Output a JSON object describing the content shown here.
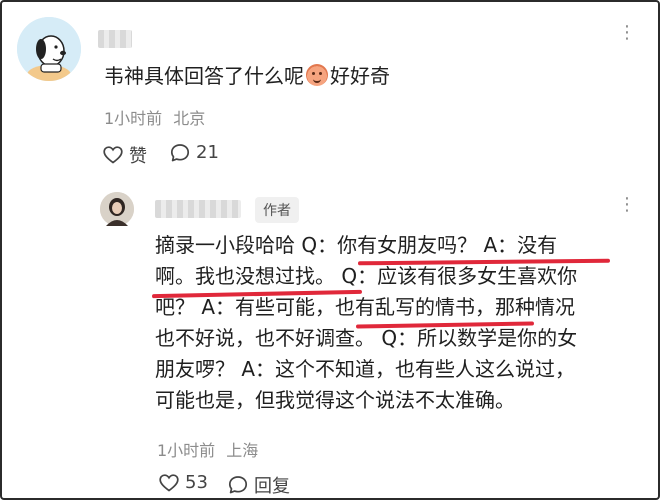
{
  "comment": {
    "text_before_emoji": "韦神具体回答了什么呢",
    "emoji_icon": "peach-face-emoji",
    "text_after_emoji": "好好奇",
    "time": "1小时前",
    "location": "北京",
    "like_label": "赞",
    "reply_count": "21"
  },
  "reply": {
    "author_badge": "作者",
    "lines": [
      "摘录一小段哈哈 Q：你有女朋友吗？ A：没有",
      "啊。我也没想过找。 Q：应该有很多女生喜欢你",
      "吧？ A：有些可能，也有乱写的情书，那种情况",
      "也不好说，也不好调查。 Q：所以数学是你的女",
      "朋友啰？ A：这个不知道，也有些人这么说过，",
      "可能也是，但我觉得这个说法不太准确。"
    ],
    "time": "1小时前",
    "location": "上海",
    "like_count": "53",
    "reply_label": "回复"
  },
  "colors": {
    "highlight_underline": "#e0283a",
    "meta_text": "#8c8c8c"
  }
}
